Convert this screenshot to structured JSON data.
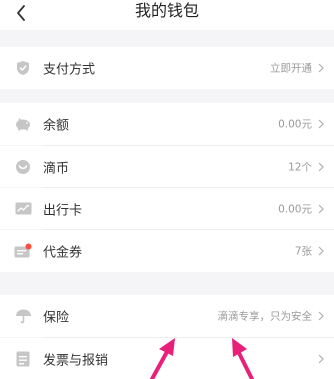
{
  "header": {
    "title": "我的钱包"
  },
  "sections": [
    {
      "items": [
        {
          "id": "payment",
          "icon": "shield-icon",
          "label": "支付方式",
          "value": "立即开通"
        }
      ]
    },
    {
      "items": [
        {
          "id": "balance",
          "icon": "piggy-bank-icon",
          "label": "余额",
          "value": "0.00元"
        },
        {
          "id": "coins",
          "icon": "coin-icon",
          "label": "滴币",
          "value": "12个"
        },
        {
          "id": "travel-card",
          "icon": "card-icon",
          "label": "出行卡",
          "value": "0.00元"
        },
        {
          "id": "vouchers",
          "icon": "ticket-icon",
          "label": "代金券",
          "value": "7张"
        }
      ]
    },
    {
      "items": [
        {
          "id": "insurance",
          "icon": "umbrella-icon",
          "label": "保险",
          "value": "滴滴专享，只为安全"
        },
        {
          "id": "invoice",
          "icon": "document-icon",
          "label": "发票与报销",
          "value": ""
        }
      ]
    }
  ],
  "colors": {
    "background": "#f5f5f7",
    "icon_gray": "#c6c6c6",
    "badge_red": "#ff4a3d",
    "annotation_arrow": "#e8207a"
  }
}
